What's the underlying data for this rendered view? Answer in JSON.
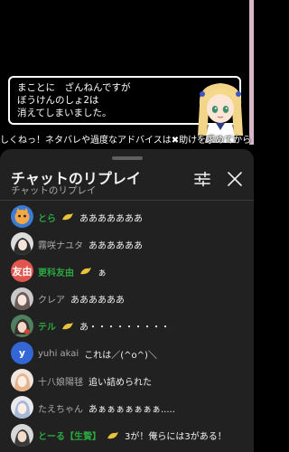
{
  "video": {
    "dialog_lines": [
      "まことに　ざんねんですが",
      "ぼうけんのしょ2は",
      "消えてしまいました。"
    ],
    "ticker": "しくねっ！ネタバレや過度なアドバイスは✖助けを求めてから"
  },
  "panel": {
    "title": "チャットのリプレイ",
    "subtitle": "チャットのリプレイ"
  },
  "messages": [
    {
      "author": "とら",
      "member": true,
      "text": "あああああああ",
      "avatar": "tora"
    },
    {
      "author": "霧咲ナユタ",
      "member": false,
      "text": "ああああああ",
      "avatar": "kirisaki"
    },
    {
      "author": "更科友由",
      "member": true,
      "text": "ぁ",
      "avatar": "text",
      "avatar_text": "友由",
      "avatar_color": "#e0564e"
    },
    {
      "author": "クレア",
      "member": false,
      "text": "ああああああ",
      "avatar": "claire"
    },
    {
      "author": "テル",
      "member": true,
      "text": "あ・・・・・・・・・",
      "avatar": "teru"
    },
    {
      "author": "yuhi akai",
      "member": false,
      "text": "これは／(^o^)＼",
      "avatar": "text",
      "avatar_text": "y",
      "avatar_color": "#3367d6"
    },
    {
      "author": "十八娘陽毬",
      "member": false,
      "text": "追い詰められた",
      "avatar": "juuhachi"
    },
    {
      "author": "たえちゃん",
      "member": false,
      "text": "あぁぁぁぁぁぁぁ.....",
      "avatar": "tae"
    },
    {
      "author": "とーる【生贄】",
      "member": true,
      "text": "3が！俺らには3がある！",
      "avatar": "tooru"
    }
  ]
}
